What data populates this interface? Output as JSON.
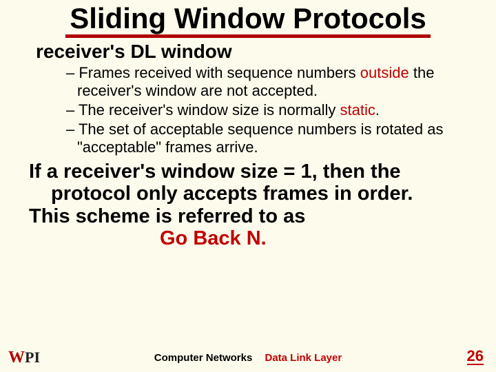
{
  "title": "Sliding Window Protocols",
  "subtitle": "receiver's DL window",
  "bullets": {
    "b1a": "Frames received with sequence numbers ",
    "b1b": "outside",
    "b1c": " the receiver's window are not accepted.",
    "b2a": "The receiver's window size is normally ",
    "b2b": "static",
    "b2c": ".",
    "b3": "The set of acceptable sequence numbers is rotated as \"acceptable\" frames arrive."
  },
  "para": {
    "p1": "If a receiver's window size = 1, then the protocol only accepts frames in order.",
    "p2a": "This scheme is referred to as",
    "p2b": "Go Back N."
  },
  "footer": {
    "left": "Computer Networks",
    "right": "Data Link Layer",
    "page": "26"
  }
}
